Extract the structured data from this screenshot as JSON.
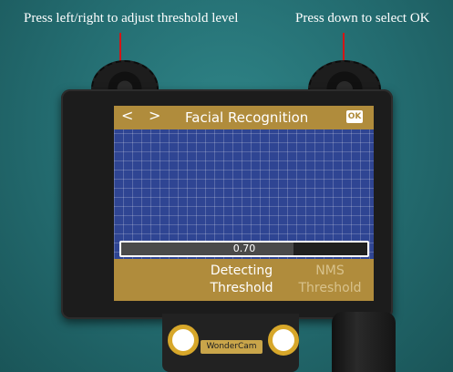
{
  "annotations": {
    "left": "Press left/right to adjust threshold level",
    "right": "Press down to select OK"
  },
  "screen": {
    "nav_prev_icon": "chevron-left-icon",
    "nav_next_icon": "chevron-right-icon",
    "nav_prev": "<",
    "nav_next": ">",
    "title": "Facial Recognition",
    "ok_label": "OK",
    "slider": {
      "value": "0.70",
      "level": 0.7
    },
    "options": [
      {
        "line1": "Detecting",
        "line2": "Threshold"
      },
      {
        "line1": "NMS",
        "line2": "Threshold"
      }
    ]
  },
  "device": {
    "brand": "WonderCam"
  },
  "colors": {
    "accent": "#b08c3c",
    "arrow": "#d41616",
    "screen": "#2f4593"
  }
}
